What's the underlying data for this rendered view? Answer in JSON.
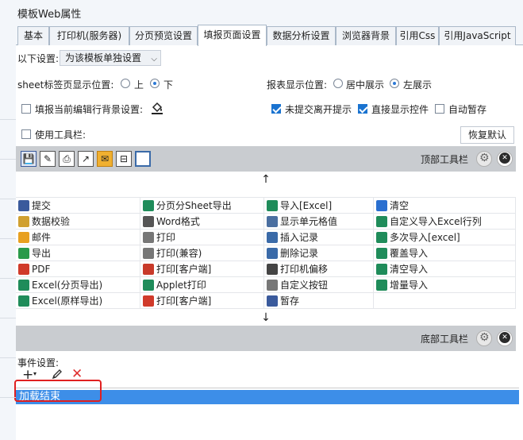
{
  "window": {
    "title": "模板Web属性"
  },
  "tabs": [
    {
      "label": "基本"
    },
    {
      "label": "打印机(服务器)"
    },
    {
      "label": "分页预览设置"
    },
    {
      "label": "填报页面设置",
      "active": true
    },
    {
      "label": "数据分析设置"
    },
    {
      "label": "浏览器背景"
    },
    {
      "label": "引用Css"
    },
    {
      "label": "引用JavaScript"
    }
  ],
  "settings": {
    "scope_label": "以下设置:",
    "scope_value": "为该模板单独设置",
    "sheet_pos_label": "sheet标签页显示位置:",
    "sheet_top": "上",
    "sheet_bottom": "下",
    "sheet_selected": "下",
    "report_pos_label": "报表显示位置:",
    "report_center": "居中展示",
    "report_left": "左展示",
    "report_selected": "左展示",
    "fill_row_bg": "填报当前编辑行背景设置:",
    "fill_row_bg_checked": false,
    "unsubmitted_tip": "未提交离开提示",
    "unsubmitted_tip_checked": true,
    "show_controls": "直接显示控件",
    "show_controls_checked": true,
    "auto_save": "自动暂存",
    "auto_save_checked": false,
    "use_toolbar": "使用工具栏:",
    "use_toolbar_checked": false,
    "restore_default": "恢复默认"
  },
  "toolbars": {
    "top_label": "顶部工具栏",
    "bottom_label": "底部工具栏",
    "top_icons": [
      "save-icon",
      "check-pencil-icon",
      "print-icon",
      "export-icon",
      "mail-icon",
      "insert-record-icon",
      "blank-icon"
    ],
    "up_arrow": "↑",
    "down_arrow": "↓"
  },
  "buttons_grid": [
    [
      {
        "label": "提交",
        "icon": "save-icon",
        "color": "#3a5a9c"
      },
      {
        "label": "分页分Sheet导出",
        "icon": "excel-icon",
        "color": "#1f8c5a"
      },
      {
        "label": "导入[Excel]",
        "icon": "excel-icon",
        "color": "#1f8c5a"
      },
      {
        "label": "清空",
        "icon": "eraser-icon",
        "color": "#2a6fd0"
      }
    ],
    [
      {
        "label": "数据校验",
        "icon": "check-pencil-icon",
        "color": "#d0a030"
      },
      {
        "label": "Word格式",
        "icon": "word-icon",
        "color": "#555555"
      },
      {
        "label": "显示单元格值",
        "icon": "blank-icon",
        "color": "#4a6fa0"
      },
      {
        "label": "自定义导入Excel行列",
        "icon": "excel-icon",
        "color": "#1f8c5a"
      }
    ],
    [
      {
        "label": "邮件",
        "icon": "mail-icon",
        "color": "#e8a020"
      },
      {
        "label": "打印",
        "icon": "print-icon",
        "color": "#777777"
      },
      {
        "label": "插入记录",
        "icon": "insert-record-icon",
        "color": "#3a6aa8"
      },
      {
        "label": "多次导入[excel]",
        "icon": "excel-icon",
        "color": "#1f8c5a"
      }
    ],
    [
      {
        "label": "导出",
        "icon": "export-icon",
        "color": "#2a9a4a"
      },
      {
        "label": "打印(兼容)",
        "icon": "print-icon",
        "color": "#777777"
      },
      {
        "label": "删除记录",
        "icon": "delete-record-icon",
        "color": "#3a6aa8"
      },
      {
        "label": "覆盖导入",
        "icon": "excel-icon",
        "color": "#1f8c5a"
      }
    ],
    [
      {
        "label": "PDF",
        "icon": "pdf-icon",
        "color": "#d03a2a"
      },
      {
        "label": "打印[客户端]",
        "icon": "flash-print-icon",
        "color": "#c83a2a"
      },
      {
        "label": "打印机偏移",
        "icon": "move-icon",
        "color": "#444444"
      },
      {
        "label": "清空导入",
        "icon": "excel-icon",
        "color": "#1f8c5a"
      }
    ],
    [
      {
        "label": "Excel(分页导出)",
        "icon": "excel-icon",
        "color": "#1f8c5a"
      },
      {
        "label": "Applet打印",
        "icon": "applet-print-icon",
        "color": "#1f8c5a"
      },
      {
        "label": "自定义按钮",
        "icon": "gear-icon",
        "color": "#777777"
      },
      {
        "label": "增量导入",
        "icon": "excel-icon",
        "color": "#1f8c5a"
      }
    ],
    [
      {
        "label": "Excel(原样导出)",
        "icon": "excel-icon",
        "color": "#1f8c5a"
      },
      {
        "label": "打印[客户端]",
        "icon": "pdf-print-icon",
        "color": "#d03a2a"
      },
      {
        "label": "暂存",
        "icon": "stash-icon",
        "color": "#3a5a9c"
      },
      {
        "label": "",
        "icon": "",
        "color": "#ffffff"
      }
    ]
  ],
  "events": {
    "label": "事件设置:",
    "items": [
      {
        "label": "加载结束",
        "selected": true
      }
    ]
  }
}
